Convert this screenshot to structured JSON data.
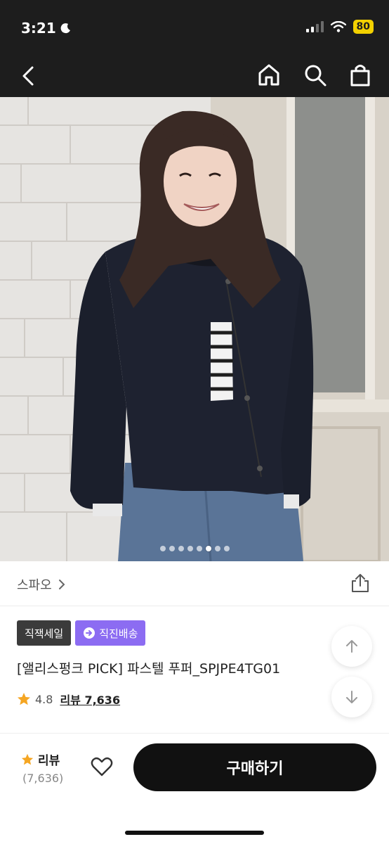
{
  "status": {
    "time": "3:21",
    "battery": "80",
    "moon_icon": "moon-icon"
  },
  "nav": {
    "back_icon": "back-arrow-icon",
    "home_icon": "home-icon",
    "search_icon": "search-icon",
    "bag_icon": "shopping-bag-icon"
  },
  "gallery": {
    "image_count": 8,
    "active_index": 5
  },
  "brand": {
    "name": "스파오",
    "chevron_icon": "chevron-right-icon",
    "share_icon": "share-icon"
  },
  "badges": [
    {
      "label": "직잭세일",
      "color": "#3b3b3b"
    },
    {
      "label": "직진배송",
      "color": "#8c6cf2",
      "icon": "delivery-icon"
    }
  ],
  "product": {
    "title": "[앨리스펑크 PICK] 파스텔 푸퍼_SPJPE4TG01",
    "rating": "4.8",
    "review_label": "리뷰 7,636"
  },
  "bottom_bar": {
    "review_label": "리뷰",
    "review_count": "(7,636)",
    "heart_icon": "heart-icon",
    "buy_label": "구매하기"
  },
  "colors": {
    "accent_purple": "#8c6cf2",
    "star": "#f5a623",
    "buy_button": "#111111"
  }
}
